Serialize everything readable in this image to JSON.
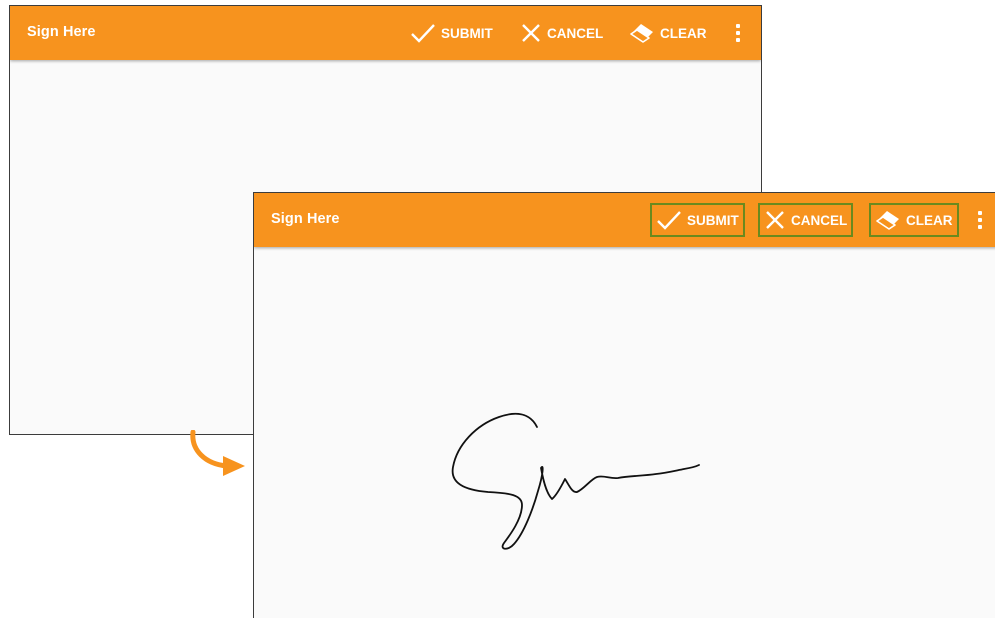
{
  "back_screen": {
    "title": "Sign Here",
    "actions": [
      {
        "label": "SUBMIT",
        "icon": "check-icon"
      },
      {
        "label": "CANCEL",
        "icon": "close-icon"
      },
      {
        "label": "CLEAR",
        "icon": "eraser-icon"
      }
    ]
  },
  "front_screen": {
    "title": "Sign Here",
    "actions": [
      {
        "label": "SUBMIT",
        "icon": "check-icon"
      },
      {
        "label": "CANCEL",
        "icon": "close-icon"
      },
      {
        "label": "CLEAR",
        "icon": "eraser-icon"
      }
    ]
  },
  "colors": {
    "toolbar": "#f7931e",
    "highlight_border": "#6a8a1e",
    "arrow": "#f7931e",
    "canvas_background": "#fafafa",
    "signature_ink": "#111111"
  }
}
